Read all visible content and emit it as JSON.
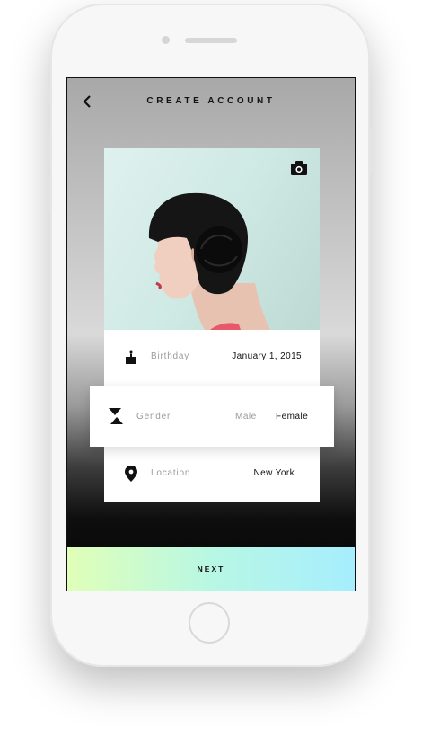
{
  "header": {
    "title": "CREATE ACCOUNT"
  },
  "icons": {
    "back": "chevron-left-icon",
    "camera": "camera-icon",
    "birthday": "cake-icon",
    "gender": "hourglass-icon",
    "location": "map-pin-icon"
  },
  "form": {
    "birthday": {
      "label": "Birthday",
      "value": "January 1, 2015"
    },
    "gender": {
      "label": "Gender",
      "options": [
        "Male",
        "Female"
      ],
      "selected": "Female"
    },
    "location": {
      "label": "Location",
      "value": "New York"
    }
  },
  "footer": {
    "next_label": "NEXT"
  },
  "colors": {
    "next_gradient_start": "#e0ffb8",
    "next_gradient_end": "#a6eefe",
    "label_gray": "#9a9a9a",
    "text_dark": "#111111"
  }
}
